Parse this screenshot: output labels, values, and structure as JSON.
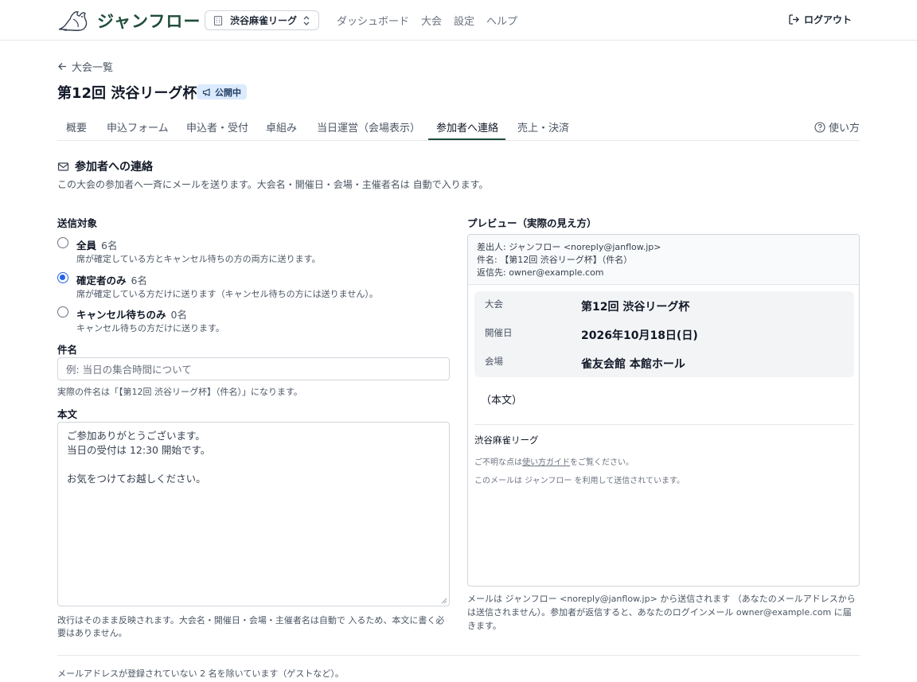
{
  "header": {
    "brand": "ジャンフロー",
    "org_name": "渋谷麻雀リーグ",
    "nav": [
      "ダッシュボード",
      "大会",
      "設定",
      "ヘルプ"
    ],
    "logout_label": "ログアウト"
  },
  "page": {
    "back_label": "大会一覧",
    "title": "第12回 渋谷リーグ杯",
    "status_badge": "公開中",
    "tabs": [
      "概要",
      "申込フォーム",
      "申込者・受付",
      "卓組み",
      "当日運営（会場表示）",
      "参加者へ連絡",
      "売上・決済"
    ],
    "active_tab": "参加者へ連絡",
    "help_label": "使い方"
  },
  "section": {
    "title": "参加者への連絡",
    "description": "この大会の参加者へ一斉にメールを送ります。大会名・開催日・会場・主催者名は 自動で入ります。"
  },
  "form": {
    "recipients_label": "送信対象",
    "recipients": [
      {
        "title": "全員",
        "count": "6名",
        "desc": "席が確定している方とキャンセル待ちの方の両方に送ります。",
        "checked": false
      },
      {
        "title": "確定者のみ",
        "count": "6名",
        "desc": "席が確定している方だけに送ります（キャンセル待ちの方には送りません）。",
        "checked": true
      },
      {
        "title": "キャンセル待ちのみ",
        "count": "0名",
        "desc": "キャンセル待ちの方だけに送ります。",
        "checked": false
      }
    ],
    "subject_label": "件名",
    "subject_placeholder": "例: 当日の集合時間について",
    "subject_hint": "実際の件名は「【第12回 渋谷リーグ杯】（件名）」になります。",
    "body_label": "本文",
    "body_value": "ご参加ありがとうございます。\n当日の受付は 12:30 開始です。\n\nお気をつけてお越しください。",
    "body_hint": "改行はそのまま反映されます。大会名・開催日・会場・主催者名は自動で 入るため、本文に書く必要はありません。"
  },
  "preview": {
    "label": "プレビュー（実際の見え方）",
    "from": "差出人: ジャンフロー <noreply@janflow.jp>",
    "subject": "件名: 【第12回 渋谷リーグ杯】（件名）",
    "reply_to": "返信先: owner@example.com",
    "info": [
      {
        "key": "大会",
        "value": "第12回 渋谷リーグ杯"
      },
      {
        "key": "開催日",
        "value": "2026年10月18日(日)"
      },
      {
        "key": "会場",
        "value": "雀友会館 本館ホール"
      }
    ],
    "body_placeholder": "（本文）",
    "org_name": "渋谷麻雀リーグ",
    "help_prefix": "ご不明な点は",
    "help_link": "使い方ガイド",
    "help_suffix": "をご覧ください。",
    "footer": "このメールは ジャンフロー を利用して送信されています。",
    "note": "メールは ジャンフロー <noreply@janflow.jp> から送信されます （あなたのメールアドレスからは送信されません）。参加者が返信すると、あなたのログインメール owner@example.com に届きます。"
  },
  "footer_note": "メールアドレスが登録されていない 2 名を除いています（ゲストなど）。",
  "colors": {
    "brand": "#1f4d3a",
    "badge_bg": "#dbeafe",
    "radio_accent": "#2563eb"
  }
}
